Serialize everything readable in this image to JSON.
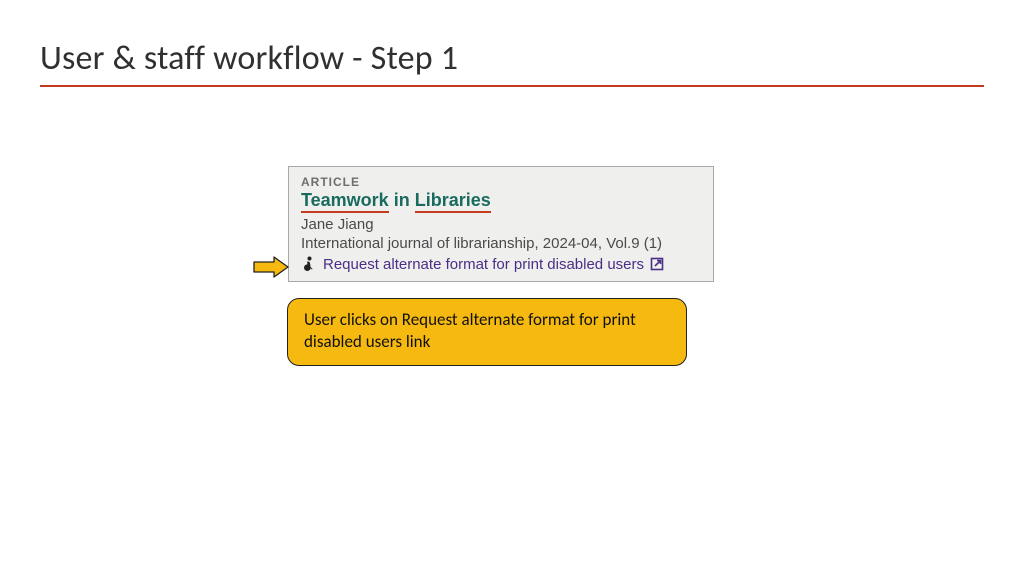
{
  "slide": {
    "title": "User & staff workflow - Step 1"
  },
  "card": {
    "type_label": "ARTICLE",
    "title_words": {
      "w1": "Teamwork",
      "w2": "in",
      "w3": "Libraries"
    },
    "author": "Jane Jiang",
    "source": "International journal of librarianship, 2024-04, Vol.9 (1)",
    "link_text": "Request alternate format for print disabled users"
  },
  "callout": {
    "text": "User clicks on Request alternate format for print disabled users link"
  },
  "colors": {
    "accent_rule": "#c53b1e",
    "title_link": "#1a6b5f",
    "link": "#4b2e86",
    "callout_bg": "#f6b90f"
  }
}
